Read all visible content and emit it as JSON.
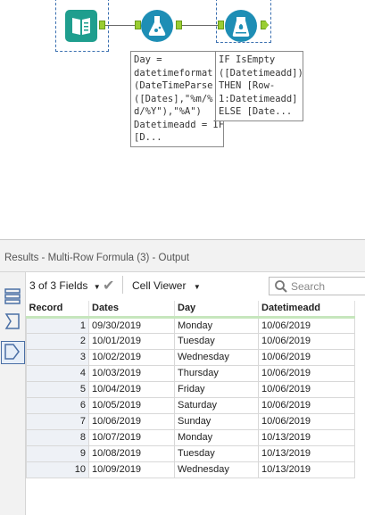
{
  "workflow": {
    "tools": [
      {
        "name": "Input Data"
      },
      {
        "name": "Formula"
      },
      {
        "name": "Multi-Row Formula"
      }
    ],
    "annotations": {
      "formula": "Day =\ndatetimeformat\n(DateTimeParse\n([Dates],\"%m/%\nd/%Y\"),\"%A\")\nDatetimeadd = IF\n[D...",
      "multirow": "IF IsEmpty\n([Datetimeadd])\nTHEN [Row-\n1:Datetimeadd]\nELSE [Date..."
    }
  },
  "results": {
    "title": "Results - Multi-Row Formula (3) - Output",
    "fields_label": "3 of 3 Fields",
    "viewer_label": "Cell Viewer",
    "search_placeholder": "Search",
    "columns": [
      "Record",
      "Dates",
      "Day",
      "Datetimeadd"
    ],
    "rows": [
      [
        "1",
        "09/30/2019",
        "Monday",
        "10/06/2019"
      ],
      [
        "2",
        "10/01/2019",
        "Tuesday",
        "10/06/2019"
      ],
      [
        "3",
        "10/02/2019",
        "Wednesday",
        "10/06/2019"
      ],
      [
        "4",
        "10/03/2019",
        "Thursday",
        "10/06/2019"
      ],
      [
        "5",
        "10/04/2019",
        "Friday",
        "10/06/2019"
      ],
      [
        "6",
        "10/05/2019",
        "Saturday",
        "10/06/2019"
      ],
      [
        "7",
        "10/06/2019",
        "Sunday",
        "10/06/2019"
      ],
      [
        "8",
        "10/07/2019",
        "Monday",
        "10/13/2019"
      ],
      [
        "9",
        "10/08/2019",
        "Tuesday",
        "10/13/2019"
      ],
      [
        "10",
        "10/09/2019",
        "Wednesday",
        "10/13/2019"
      ]
    ]
  },
  "colors": {
    "input_tool": "#1f9e8e",
    "formula_tool": "#1e8eb5",
    "multirow_tool": "#1e8eb5",
    "anchor": "#9acd32",
    "header_underline": "#c6e6bd"
  }
}
